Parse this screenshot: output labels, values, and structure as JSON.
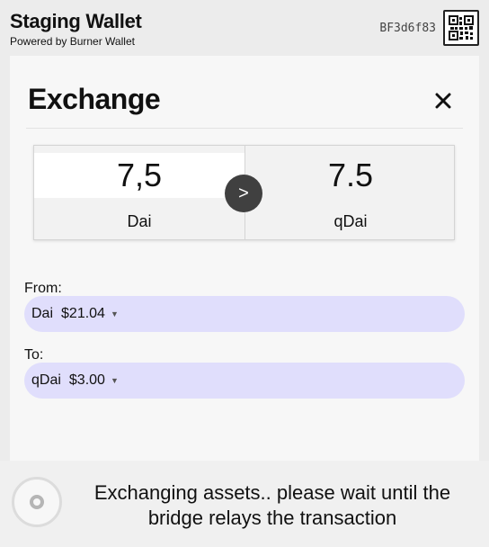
{
  "header": {
    "title": "Staging Wallet",
    "subtitle": "Powered by Burner Wallet",
    "account_id": "BF3d6f83",
    "qr_icon": "qr-code-icon"
  },
  "exchange": {
    "title": "Exchange",
    "close_icon": "close-icon",
    "from_amount": "7,5",
    "from_asset": "Dai",
    "to_amount": "7.5",
    "to_asset": "qDai",
    "swap_label": ">"
  },
  "from": {
    "label": "From:",
    "asset": "Dai",
    "balance": "$21.04",
    "caret": "▼"
  },
  "to": {
    "label": "To:",
    "asset": "qDai",
    "balance": "$3.00",
    "caret": "▼"
  },
  "status": {
    "message": "Exchanging assets.. please wait until the bridge relays the transaction"
  },
  "colors": {
    "select_bg": "#e0defc",
    "swap_bg": "#404040"
  }
}
